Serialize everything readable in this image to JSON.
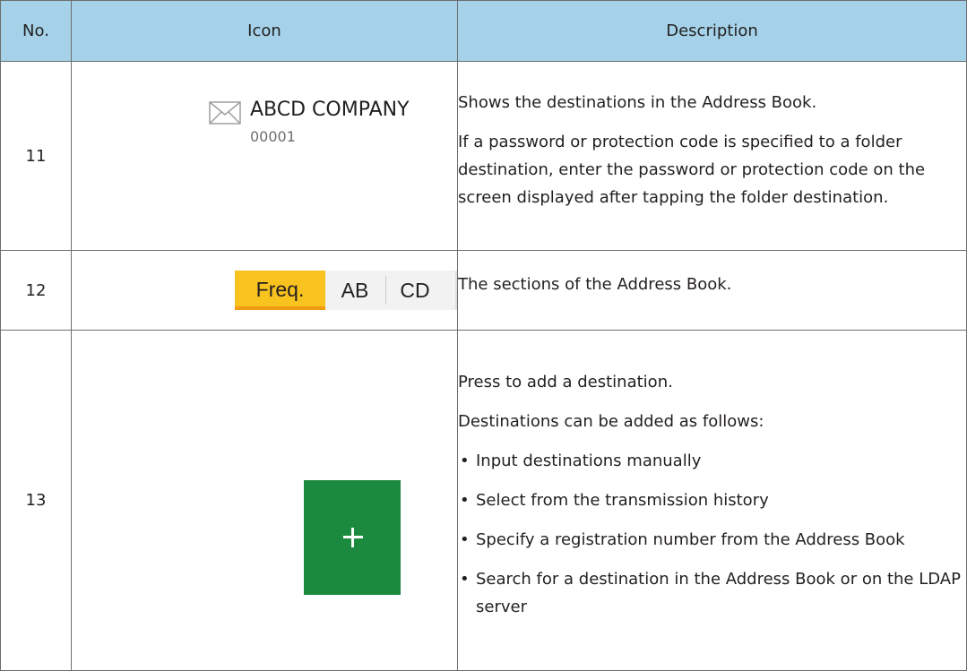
{
  "table": {
    "headers": {
      "no": "No.",
      "icon": "Icon",
      "description": "Description"
    },
    "rows": [
      {
        "no": "11",
        "icon": {
          "type": "address-book-entry",
          "icon_name": "envelope-icon",
          "name": "ABCD COMPANY",
          "number": "00001"
        },
        "description": [
          "Shows the destinations in the Address Book.",
          "If a password or protection code is specified to a folder destination, enter the password or protection code on the screen displayed after tapping the folder destination."
        ]
      },
      {
        "no": "12",
        "icon": {
          "type": "section-tabs",
          "tabs": [
            "Freq.",
            "AB",
            "CD"
          ],
          "selected": "Freq.",
          "selected_color": "#f9c31f"
        },
        "description": [
          "The sections of the Address Book."
        ]
      },
      {
        "no": "13",
        "icon": {
          "type": "add-button",
          "icon_name": "plus-icon",
          "color": "#1b8a3e"
        },
        "description": [
          "Press to add a destination.",
          "Destinations can be added as follows:"
        ],
        "bullets": [
          "Input destinations manually",
          "Select from the transmission history",
          "Specify a registration number from the Address Book",
          "Search for a destination in the Address Book or on the LDAP server"
        ]
      }
    ]
  },
  "colors": {
    "header_background": "#a5d2e9",
    "border": "#6d6e71"
  }
}
